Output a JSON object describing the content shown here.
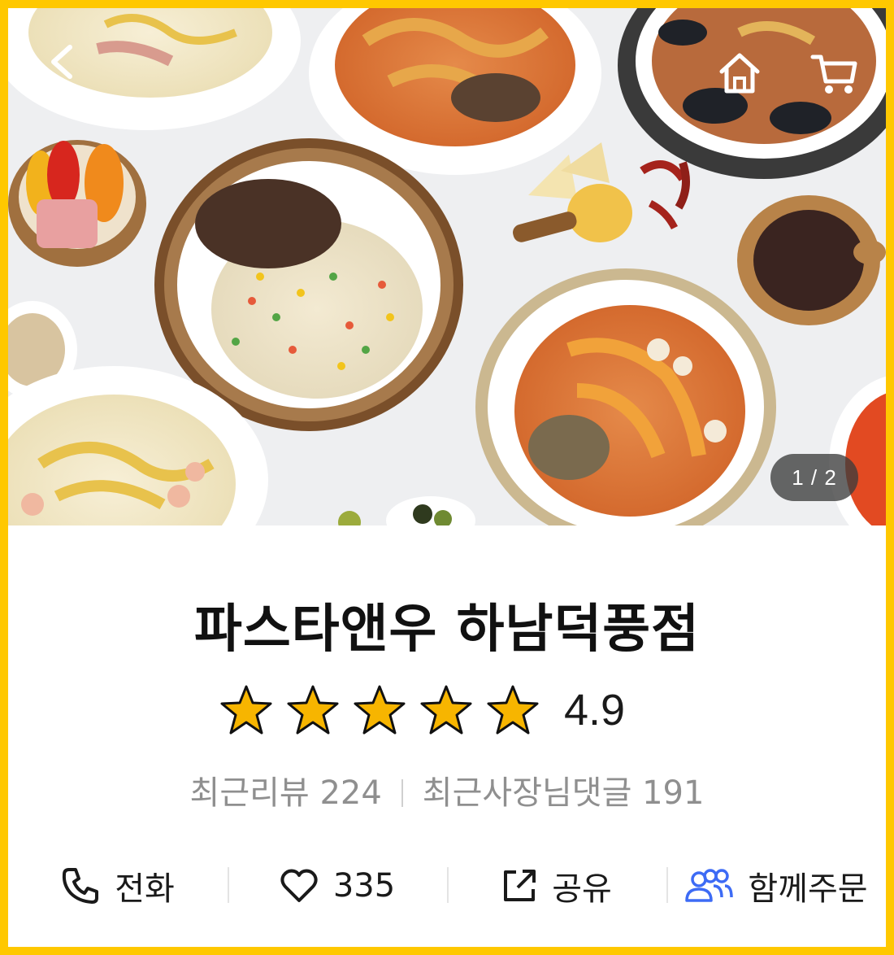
{
  "header": {
    "back_icon": "chevron-left-icon",
    "home_icon": "home-icon",
    "cart_icon": "cart-icon"
  },
  "gallery": {
    "counter": "1 / 2"
  },
  "store": {
    "name": "파스타앤우 하남덕풍점",
    "rating_value": "4.9",
    "rating_stars": 5,
    "recent_reviews_label": "최근리뷰 224",
    "recent_owner_replies_label": "최근사장님댓글 191"
  },
  "actions": {
    "call_label": "전화",
    "like_count": "335",
    "share_label": "공유",
    "group_order_label": "함께주문"
  },
  "colors": {
    "frame": "#FFC800",
    "star": "#F7B500",
    "group_order_icon": "#3D6BF5"
  }
}
